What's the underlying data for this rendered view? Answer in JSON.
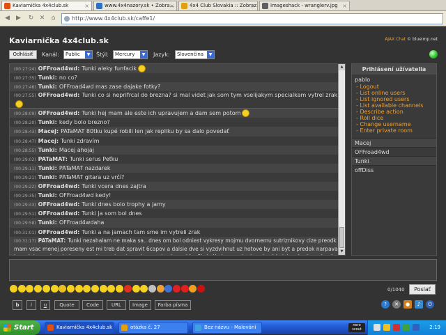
{
  "browser": {
    "tabs": [
      {
        "label": "Kaviarnička 4x4club.sk",
        "active": true,
        "color": "#e05010"
      },
      {
        "label": "www.4x4nazory.sk • Zobra...",
        "active": false,
        "color": "#3070c0"
      },
      {
        "label": "4x4 Club Slovakia :: Zobraz...",
        "active": false,
        "color": "#e0a010"
      },
      {
        "label": "Imageshack - wranglerv.jpg",
        "active": false,
        "color": "#606060"
      }
    ],
    "url": "http://www.4x4club.sk/caffe1/"
  },
  "header": {
    "title": "Kaviarnička 4x4club.sk",
    "credit_prefix": "AJAX Chat",
    "credit_suffix": "© blueimp.net"
  },
  "toolbar": {
    "logout": "Odhlásiť",
    "channel_label": "Kanál:",
    "channel_value": "Public",
    "style_label": "Štýl:",
    "style_value": "Mercury",
    "language_label": "Jazyk:",
    "language_value": "Slovenčina"
  },
  "messages": [
    {
      "time": "(00:27:24)",
      "user": "OFFroad4wd:",
      "text": "Tunki aleky funfacik",
      "smile": true,
      "cls": "alt"
    },
    {
      "time": "(00:27:35)",
      "user": "Tunki:",
      "text": "no co?",
      "smile": false,
      "cls": ""
    },
    {
      "time": "(00:27:46)",
      "user": "Tunki:",
      "text": "OFFroad4wd mas zase dajake fotky?",
      "smile": false,
      "cls": "alt"
    },
    {
      "time": "(00:27:55)",
      "user": "OFFroad4wd:",
      "text": "Tunki co si neprifrcal do brezna? si mal videt jak som tym vselijakym specialkam vytrel zrak",
      "smile": true,
      "cls": "tall"
    },
    {
      "time": "(00:28:09)",
      "user": "OFFroad4wd:",
      "text": "Tunki hej mam ale este ich upravujem a dam sem potom",
      "smile": true,
      "cls": "alt"
    },
    {
      "time": "(00:28:20)",
      "user": "Tunki:",
      "text": "kedy bolo brezno?",
      "smile": false,
      "cls": ""
    },
    {
      "time": "(00:28:43)",
      "user": "Macej:",
      "text": "PATaMAT 80tku kupé robili len jak repliku by sa dalo povedať",
      "smile": false,
      "cls": "alt"
    },
    {
      "time": "(00:28:47)",
      "user": "Macej:",
      "text": "Tunki zdravím",
      "smile": false,
      "cls": ""
    },
    {
      "time": "(00:28:55)",
      "user": "Tunki:",
      "text": "Macej ahojaj",
      "smile": false,
      "cls": "alt"
    },
    {
      "time": "(00:29:02)",
      "user": "PATaMAT:",
      "text": "Tunki serus Peťku",
      "smile": false,
      "cls": ""
    },
    {
      "time": "(00:29:11)",
      "user": "Tunki:",
      "text": "PATaMAT nazdarek",
      "smile": false,
      "cls": "alt"
    },
    {
      "time": "(00:29:21)",
      "user": "Tunki:",
      "text": "PATaMAT gitara uz vrčí?",
      "smile": false,
      "cls": ""
    },
    {
      "time": "(00:29:22)",
      "user": "OFFroad4wd:",
      "text": "Tunki vcera dnes zajtra",
      "smile": false,
      "cls": "alt"
    },
    {
      "time": "(00:29:35)",
      "user": "Tunki:",
      "text": "OFFroad4wd kedy!",
      "smile": false,
      "cls": ""
    },
    {
      "time": "(00:29:43)",
      "user": "OFFroad4wd:",
      "text": "Tunki dnes bolo trophy a jamy",
      "smile": false,
      "cls": "alt"
    },
    {
      "time": "(00:29:51)",
      "user": "OFFroad4wd:",
      "text": "Tunki ja som bol dnes",
      "smile": false,
      "cls": ""
    },
    {
      "time": "(00:29:58)",
      "user": "Tunki:",
      "text": "OFFroad4wdaha",
      "smile": false,
      "cls": "alt"
    },
    {
      "time": "(00:31:01)",
      "user": "OFFroad4wd:",
      "text": "Tunki a na jamach tam sme im vytreli zrak",
      "smile": false,
      "cls": ""
    },
    {
      "time": "(00:31:17)",
      "user": "PATaMAT:",
      "text": "Tunki nezahalam ne maka sa.. dnes om bol odniest vykresy mojmu dvornemu sutriznikovy cize preodk mam vsac menej poreseny est mi treb dat spravit 6capov a dalsie dve si vyzdvihnut uz hotove by ani byt a predok narpava kompletna a dozadu by som zajtr amal mat pruziny cez tyzdne pridu dlhsie tlmice a este dozadu objednie a bude na kardan a ajdo do vsetkeho a som mam pochystane a postupne sa",
      "smile": false,
      "cls": "big alt"
    }
  ],
  "sidebar": {
    "title": "Prihlásení užívatelia",
    "current_user": "pablo",
    "menu": [
      "Logout",
      "List online users",
      "List ignored users",
      "List available channels",
      "Describe action",
      "Roll dice",
      "Change username",
      "Enter private room"
    ],
    "users": [
      "Macej",
      "OFFroad4wd",
      "Tunki",
      "offDiss"
    ]
  },
  "input": {
    "counter": "0/1040",
    "send": "Poslať"
  },
  "emoticons": [
    "#f4d020",
    "#f4d020",
    "#f4d020",
    "#f4d020",
    "#f4d020",
    "#f4d020",
    "#e8c020",
    "#f4d020",
    "#f4d020",
    "#f4d020",
    "#f4d020",
    "#f4d020",
    "#f4d020",
    "#f4d020",
    "#e03020",
    "#f4d020",
    "#f4d020",
    "#c0c0c0",
    "#f0a030",
    "#4070d0",
    "#e02020",
    "#e02020",
    "#f0a020",
    "#d01010"
  ],
  "format": {
    "bold": "b",
    "italic": "i",
    "underline": "u",
    "quote": "Quote",
    "code": "Code",
    "url": "URL",
    "image": "Image",
    "color": "Farba písma"
  },
  "taskbar": {
    "start": "Start",
    "tasks": [
      {
        "label": "Kaviarnička 4x4club.sk",
        "active": true,
        "color": "#e05010"
      },
      {
        "label": "otázka č. 27",
        "active": false,
        "color": "#e0a010"
      },
      {
        "label": "Bez názvu - Malování",
        "active": false,
        "color": "#40a0e0"
      }
    ],
    "time": "2:19"
  }
}
